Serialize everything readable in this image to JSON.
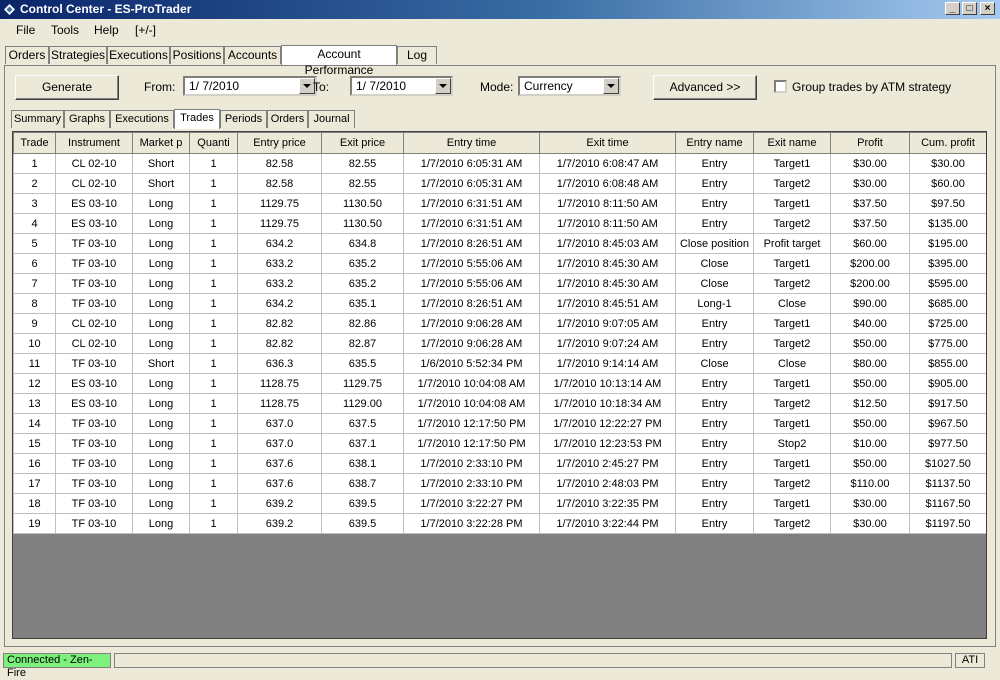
{
  "window": {
    "title": "Control Center - ES-ProTrader",
    "min_glyph": "_",
    "max_glyph": "□",
    "close_glyph": "×"
  },
  "menu": [
    "File",
    "Tools",
    "Help",
    "[+/-]"
  ],
  "main_tabs": [
    "Orders",
    "Strategies",
    "Executions",
    "Positions",
    "Accounts",
    "Account Performance",
    "Log"
  ],
  "controls": {
    "generate_label": "Generate",
    "from_label": "From:",
    "from_value": "1/ 7/2010",
    "to_label": "To:",
    "to_value": "1/ 7/2010",
    "mode_label": "Mode:",
    "mode_value": "Currency",
    "advanced_label": "Advanced >>",
    "group_label": "Group trades by ATM strategy"
  },
  "sub_tabs": [
    "Summary",
    "Graphs",
    "Executions",
    "Trades",
    "Periods",
    "Orders",
    "Journal"
  ],
  "table": {
    "columns": [
      "Trade",
      "Instrument",
      "Market p",
      "Quanti",
      "Entry price",
      "Exit price",
      "Entry time",
      "Exit time",
      "Entry name",
      "Exit name",
      "Profit",
      "Cum. profit"
    ],
    "rows": [
      [
        "1",
        "CL 02-10",
        "Short",
        "1",
        "82.58",
        "82.55",
        "1/7/2010 6:05:31 AM",
        "1/7/2010 6:08:47 AM",
        "Entry",
        "Target1",
        "$30.00",
        "$30.00"
      ],
      [
        "2",
        "CL 02-10",
        "Short",
        "1",
        "82.58",
        "82.55",
        "1/7/2010 6:05:31 AM",
        "1/7/2010 6:08:48 AM",
        "Entry",
        "Target2",
        "$30.00",
        "$60.00"
      ],
      [
        "3",
        "ES 03-10",
        "Long",
        "1",
        "1129.75",
        "1130.50",
        "1/7/2010 6:31:51 AM",
        "1/7/2010 8:11:50 AM",
        "Entry",
        "Target1",
        "$37.50",
        "$97.50"
      ],
      [
        "4",
        "ES 03-10",
        "Long",
        "1",
        "1129.75",
        "1130.50",
        "1/7/2010 6:31:51 AM",
        "1/7/2010 8:11:50 AM",
        "Entry",
        "Target2",
        "$37.50",
        "$135.00"
      ],
      [
        "5",
        "TF 03-10",
        "Long",
        "1",
        "634.2",
        "634.8",
        "1/7/2010 8:26:51 AM",
        "1/7/2010 8:45:03 AM",
        "Close position",
        "Profit target",
        "$60.00",
        "$195.00"
      ],
      [
        "6",
        "TF 03-10",
        "Long",
        "1",
        "633.2",
        "635.2",
        "1/7/2010 5:55:06 AM",
        "1/7/2010 8:45:30 AM",
        "Close",
        "Target1",
        "$200.00",
        "$395.00"
      ],
      [
        "7",
        "TF 03-10",
        "Long",
        "1",
        "633.2",
        "635.2",
        "1/7/2010 5:55:06 AM",
        "1/7/2010 8:45:30 AM",
        "Close",
        "Target2",
        "$200.00",
        "$595.00"
      ],
      [
        "8",
        "TF 03-10",
        "Long",
        "1",
        "634.2",
        "635.1",
        "1/7/2010 8:26:51 AM",
        "1/7/2010 8:45:51 AM",
        "Long-1",
        "Close",
        "$90.00",
        "$685.00"
      ],
      [
        "9",
        "CL 02-10",
        "Long",
        "1",
        "82.82",
        "82.86",
        "1/7/2010 9:06:28 AM",
        "1/7/2010 9:07:05 AM",
        "Entry",
        "Target1",
        "$40.00",
        "$725.00"
      ],
      [
        "10",
        "CL 02-10",
        "Long",
        "1",
        "82.82",
        "82.87",
        "1/7/2010 9:06:28 AM",
        "1/7/2010 9:07:24 AM",
        "Entry",
        "Target2",
        "$50.00",
        "$775.00"
      ],
      [
        "11",
        "TF 03-10",
        "Short",
        "1",
        "636.3",
        "635.5",
        "1/6/2010 5:52:34 PM",
        "1/7/2010 9:14:14 AM",
        "Close",
        "Close",
        "$80.00",
        "$855.00"
      ],
      [
        "12",
        "ES 03-10",
        "Long",
        "1",
        "1128.75",
        "1129.75",
        "1/7/2010 10:04:08 AM",
        "1/7/2010 10:13:14 AM",
        "Entry",
        "Target1",
        "$50.00",
        "$905.00"
      ],
      [
        "13",
        "ES 03-10",
        "Long",
        "1",
        "1128.75",
        "1129.00",
        "1/7/2010 10:04:08 AM",
        "1/7/2010 10:18:34 AM",
        "Entry",
        "Target2",
        "$12.50",
        "$917.50"
      ],
      [
        "14",
        "TF 03-10",
        "Long",
        "1",
        "637.0",
        "637.5",
        "1/7/2010 12:17:50 PM",
        "1/7/2010 12:22:27 PM",
        "Entry",
        "Target1",
        "$50.00",
        "$967.50"
      ],
      [
        "15",
        "TF 03-10",
        "Long",
        "1",
        "637.0",
        "637.1",
        "1/7/2010 12:17:50 PM",
        "1/7/2010 12:23:53 PM",
        "Entry",
        "Stop2",
        "$10.00",
        "$977.50"
      ],
      [
        "16",
        "TF 03-10",
        "Long",
        "1",
        "637.6",
        "638.1",
        "1/7/2010 2:33:10 PM",
        "1/7/2010 2:45:27 PM",
        "Entry",
        "Target1",
        "$50.00",
        "$1027.50"
      ],
      [
        "17",
        "TF 03-10",
        "Long",
        "1",
        "637.6",
        "638.7",
        "1/7/2010 2:33:10 PM",
        "1/7/2010 2:48:03 PM",
        "Entry",
        "Target2",
        "$110.00",
        "$1137.50"
      ],
      [
        "18",
        "TF 03-10",
        "Long",
        "1",
        "639.2",
        "639.5",
        "1/7/2010 3:22:27 PM",
        "1/7/2010 3:22:35 PM",
        "Entry",
        "Target1",
        "$30.00",
        "$1167.50"
      ],
      [
        "19",
        "TF 03-10",
        "Long",
        "1",
        "639.2",
        "639.5",
        "1/7/2010 3:22:28 PM",
        "1/7/2010 3:22:44 PM",
        "Entry",
        "Target2",
        "$30.00",
        "$1197.50"
      ]
    ]
  },
  "status": {
    "connection": "Connected - Zen-Fire",
    "connection_color": "#7cf27c",
    "right": "ATI"
  }
}
